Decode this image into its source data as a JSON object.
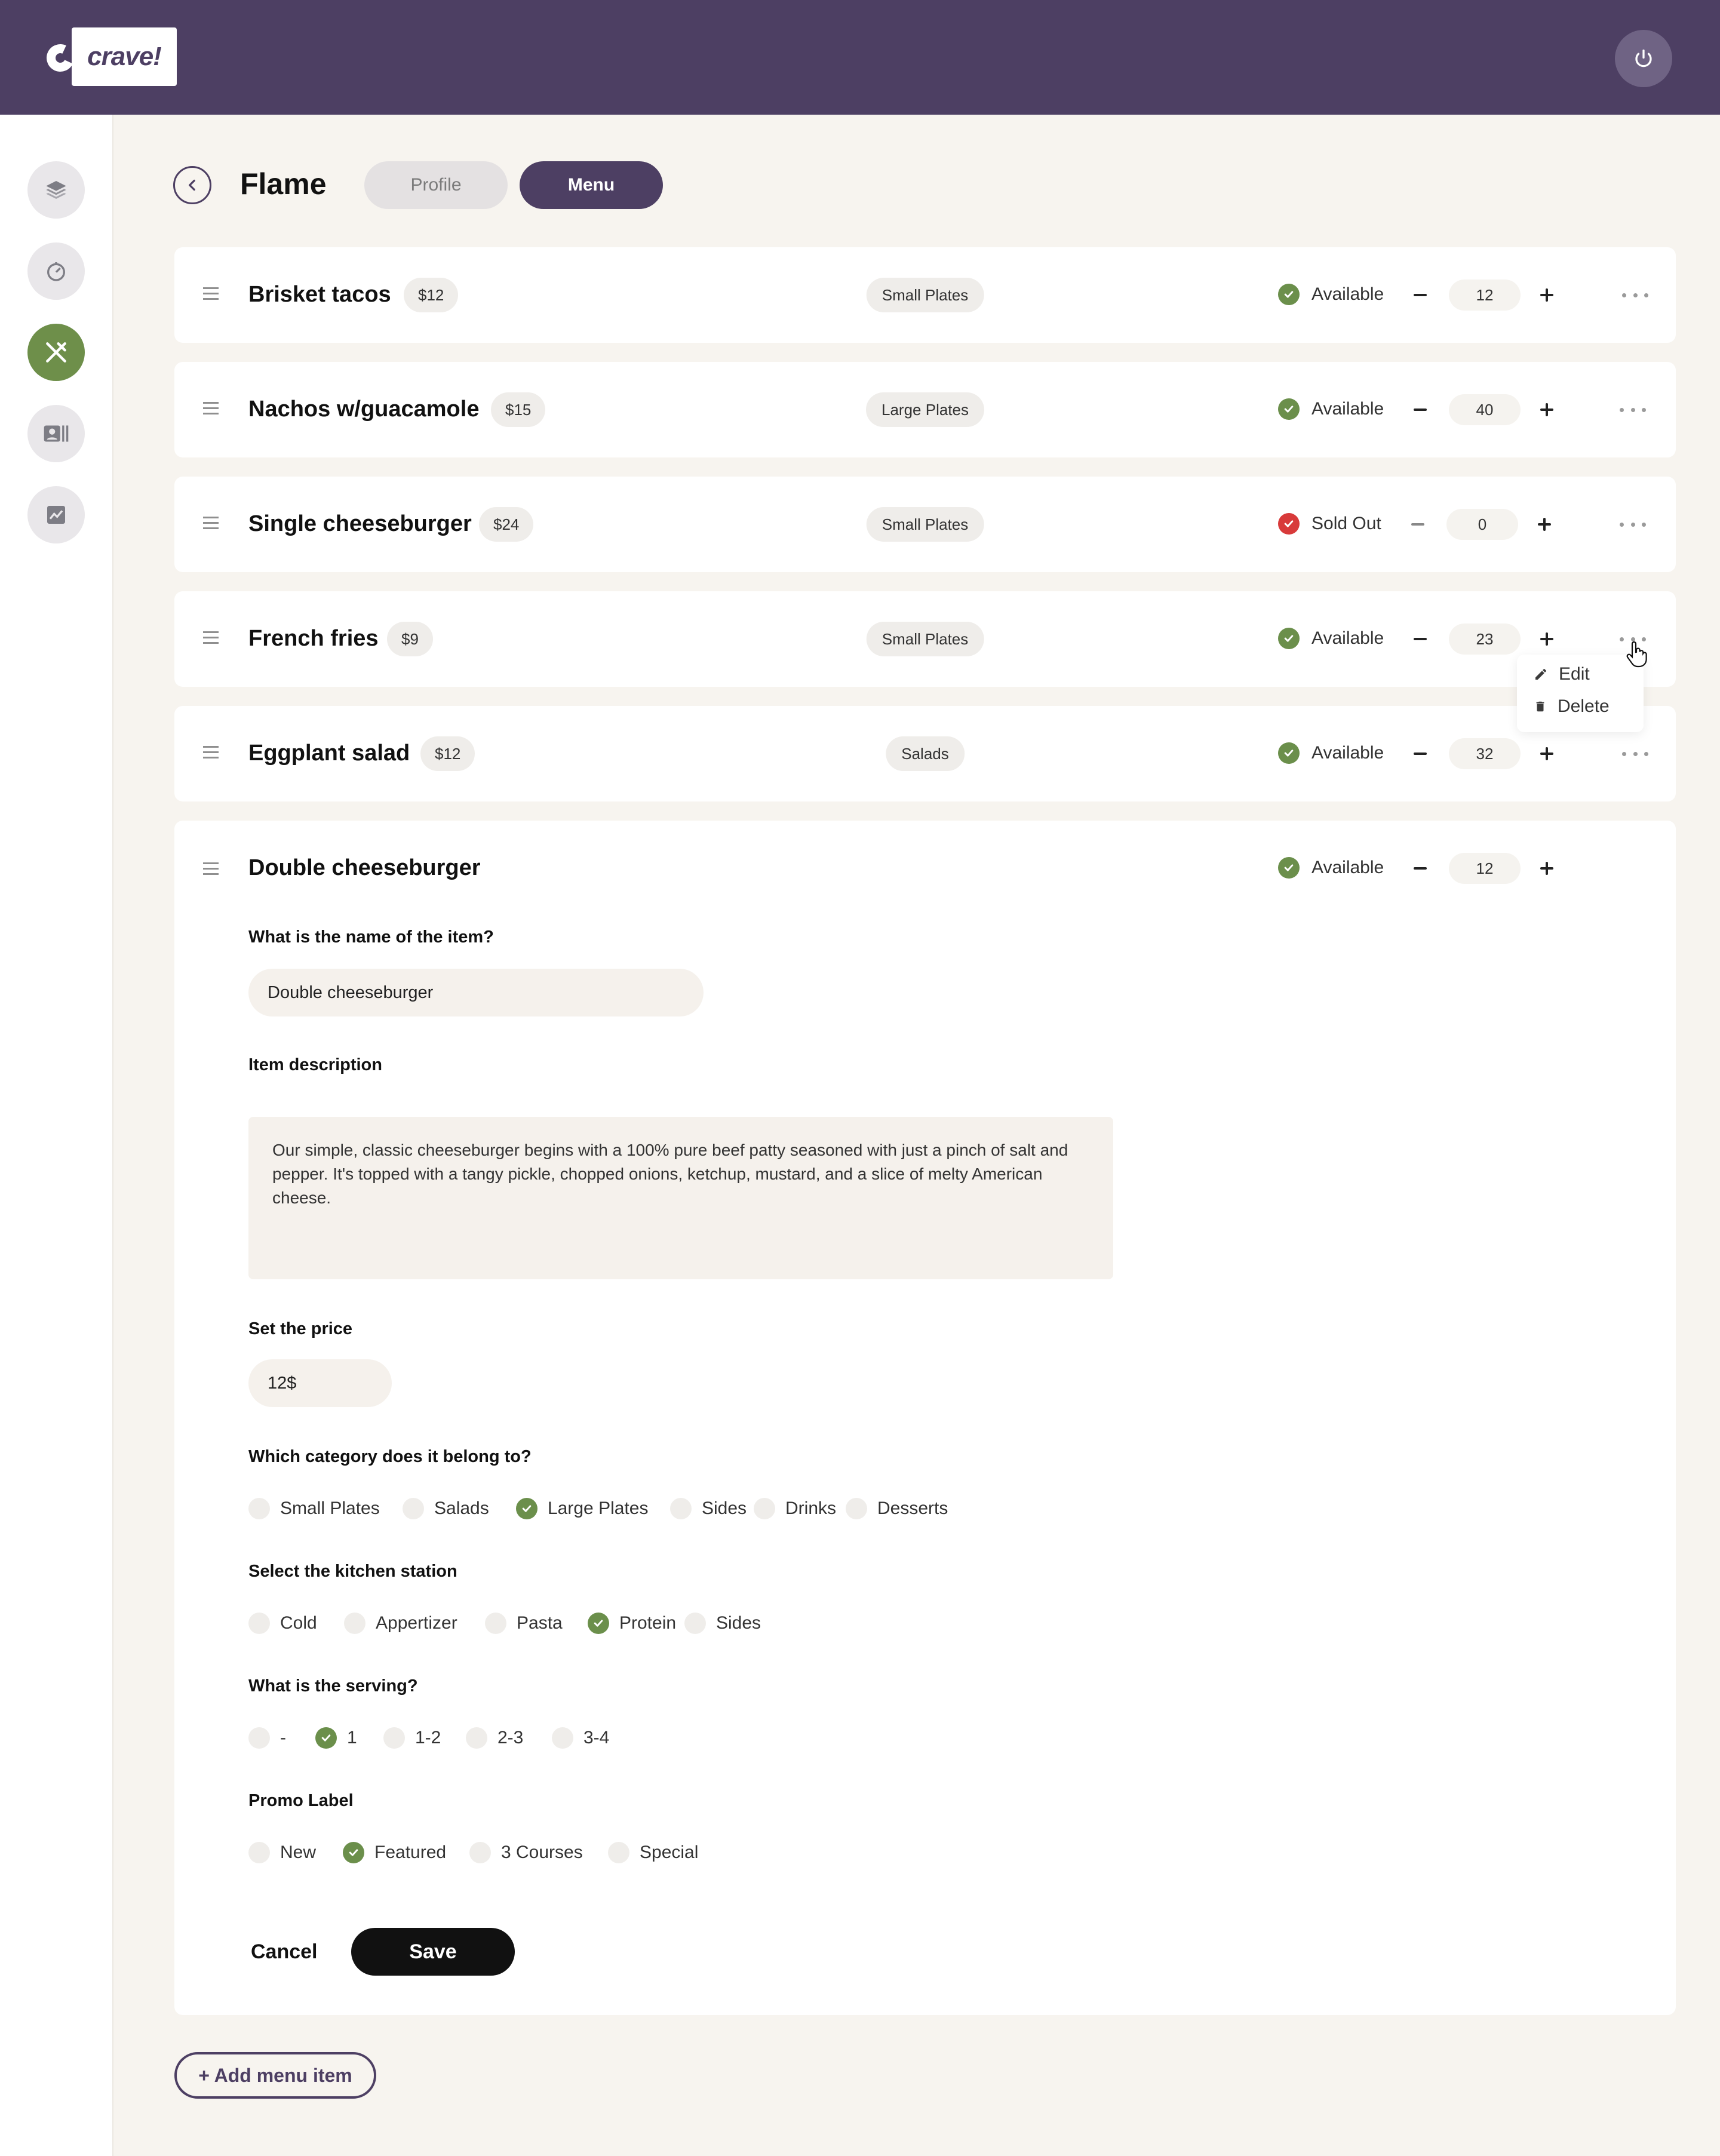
{
  "header": {
    "logo_text": "crave!",
    "power_icon": "power-icon"
  },
  "sidebar": {
    "items": [
      {
        "icon": "layers-icon"
      },
      {
        "icon": "timer-icon"
      },
      {
        "icon": "utensils-icon",
        "active": true
      },
      {
        "icon": "profile-card-icon"
      },
      {
        "icon": "analytics-icon"
      }
    ]
  },
  "page": {
    "title": "Flame",
    "tabs": [
      {
        "label": "Profile"
      },
      {
        "label": "Menu",
        "active": true
      }
    ]
  },
  "items": [
    {
      "name": "Brisket tacos",
      "price": "$12",
      "category": "Small Plates",
      "status": "Available",
      "qty": "12"
    },
    {
      "name": "Nachos w/guacamole",
      "price": "$15",
      "category": "Large Plates",
      "status": "Available",
      "qty": "40"
    },
    {
      "name": "Single cheeseburger",
      "price": "$24",
      "category": "Small Plates",
      "status": "Sold Out",
      "qty": "0"
    },
    {
      "name": "French fries",
      "price": "$9",
      "category": "Small Plates",
      "status": "Available",
      "qty": "23"
    },
    {
      "name": "Eggplant salad",
      "price": "$12",
      "category": "Salads",
      "status": "Available",
      "qty": "32"
    }
  ],
  "context_menu": {
    "edit": "Edit",
    "delete": "Delete"
  },
  "editing": {
    "name": "Double cheeseburger",
    "status": "Available",
    "qty": "12",
    "name_question": "What is the name of the item?",
    "name_value": "Double cheeseburger",
    "desc_label": "Item description",
    "desc_value": "Our simple, classic cheeseburger begins with a 100% pure beef patty seasoned with just a pinch of salt and pepper. It's topped with a tangy pickle, chopped onions, ketchup, mustard, and a slice of melty American cheese.",
    "price_label": "Set the price",
    "price_value": "12$",
    "category_question": "Which category does it belong to?",
    "categories": [
      "Small Plates",
      "Salads",
      "Large Plates",
      "Sides",
      "Drinks",
      "Desserts"
    ],
    "category_selected": "Large Plates",
    "station_question": "Select the kitchen station",
    "stations": [
      "Cold",
      "Appertizer",
      "Pasta",
      "Protein",
      "Sides"
    ],
    "station_selected": "Protein",
    "serving_question": "What is the serving?",
    "servings": [
      "-",
      "1",
      "1-2",
      "2-3",
      "3-4"
    ],
    "serving_selected": "1",
    "promo_question": "Promo Label",
    "promos": [
      "New",
      "Featured",
      "3 Courses",
      "Special"
    ],
    "promo_selected": "Featured",
    "cancel_label": "Cancel",
    "save_label": "Save"
  },
  "add_button_label": "+ Add menu item",
  "colors": {
    "header": "#4d3f63",
    "accent_green": "#6b8f4b",
    "sold_out_red": "#d83a3a",
    "background": "#f7f4ef"
  }
}
